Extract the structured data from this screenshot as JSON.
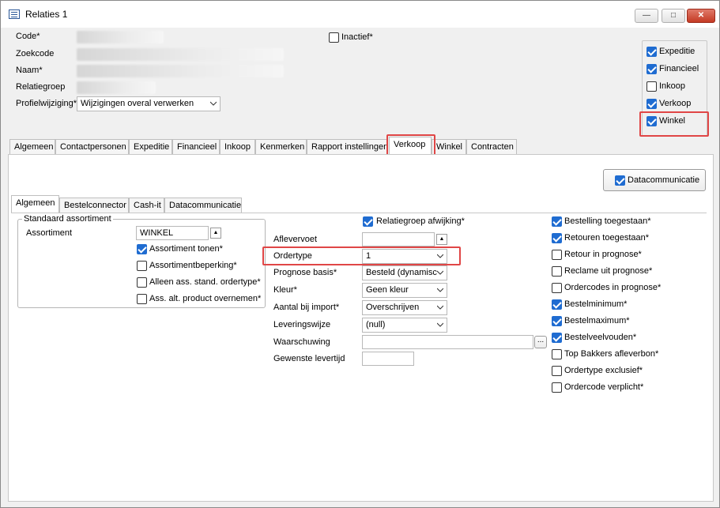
{
  "window": {
    "title": "Relaties 1",
    "minimize_glyph": "—",
    "maximize_glyph": "□",
    "close_glyph": "✕"
  },
  "header": {
    "code_label": "Code*",
    "zoekcode_label": "Zoekcode",
    "naam_label": "Naam*",
    "relatiegroep_label": "Relatiegroep",
    "profielwijziging_label": "Profielwijziging*",
    "profielwijziging_value": "Wijzigingen overal verwerken",
    "inactief_label": "Inactief*"
  },
  "role_checks": [
    {
      "label": "Expeditie",
      "checked": true
    },
    {
      "label": "Financieel",
      "checked": true
    },
    {
      "label": "Inkoop",
      "checked": false
    },
    {
      "label": "Verkoop",
      "checked": true
    },
    {
      "label": "Winkel",
      "checked": true
    }
  ],
  "main_tabs": [
    "Algemeen",
    "Contactpersonen",
    "Expeditie",
    "Financieel",
    "Inkoop",
    "Kenmerken",
    "Rapport instellingen",
    "Verkoop",
    "Winkel",
    "Contracten"
  ],
  "active_main_tab": "Verkoop",
  "datacommunicatie_button": {
    "label": "Datacommunicatie",
    "checked": true
  },
  "sub_tabs": [
    "Algemeen",
    "Bestelconnector",
    "Cash-it",
    "Datacommunicatie"
  ],
  "active_sub_tab": "Algemeen",
  "standaard_assortiment": {
    "legend": "Standaard assortiment",
    "assortiment_label": "Assortiment",
    "assortiment_value": "WINKEL",
    "checks": [
      {
        "label": "Assortiment tonen*",
        "checked": true
      },
      {
        "label": "Assortimentbeperking*",
        "checked": false
      },
      {
        "label": "Alleen ass. stand. ordertype*",
        "checked": false
      },
      {
        "label": "Ass. alt. product overnemen*",
        "checked": false
      }
    ]
  },
  "middle": {
    "relatiegroep_afwijking": {
      "label": "Relatiegroep afwijking*",
      "checked": true
    },
    "aflevervoet_label": "Aflevervoet",
    "ordertype_label": "Ordertype",
    "ordertype_value": "1",
    "prognose_label": "Prognose basis*",
    "prognose_value": "Besteld (dynamisc",
    "kleur_label": "Kleur*",
    "kleur_value": "Geen kleur",
    "aantal_label": "Aantal bij import*",
    "aantal_value": "Overschrijven",
    "leveringswijze_label": "Leveringswijze",
    "leveringswijze_value": "(null)",
    "waarschuwing_label": "Waarschuwing",
    "ellipsis": "...",
    "gewenste_label": "Gewenste levertijd"
  },
  "right_checks": [
    {
      "label": "Bestelling toegestaan*",
      "checked": true
    },
    {
      "label": "Retouren toegestaan*",
      "checked": true
    },
    {
      "label": "Retour in prognose*",
      "checked": false
    },
    {
      "label": "Reclame uit prognose*",
      "checked": false
    },
    {
      "label": "Ordercodes in prognose*",
      "checked": false
    },
    {
      "label": "Bestelminimum*",
      "checked": true
    },
    {
      "label": "Bestelmaximum*",
      "checked": true
    },
    {
      "label": "Bestelveelvouden*",
      "checked": true
    },
    {
      "label": "Top Bakkers afleverbon*",
      "checked": false
    },
    {
      "label": "Ordertype exclusief*",
      "checked": false
    },
    {
      "label": "Ordercode verplicht*",
      "checked": false
    }
  ],
  "colors": {
    "highlight": "#e04646",
    "check_blue": "#1f6cd1"
  }
}
